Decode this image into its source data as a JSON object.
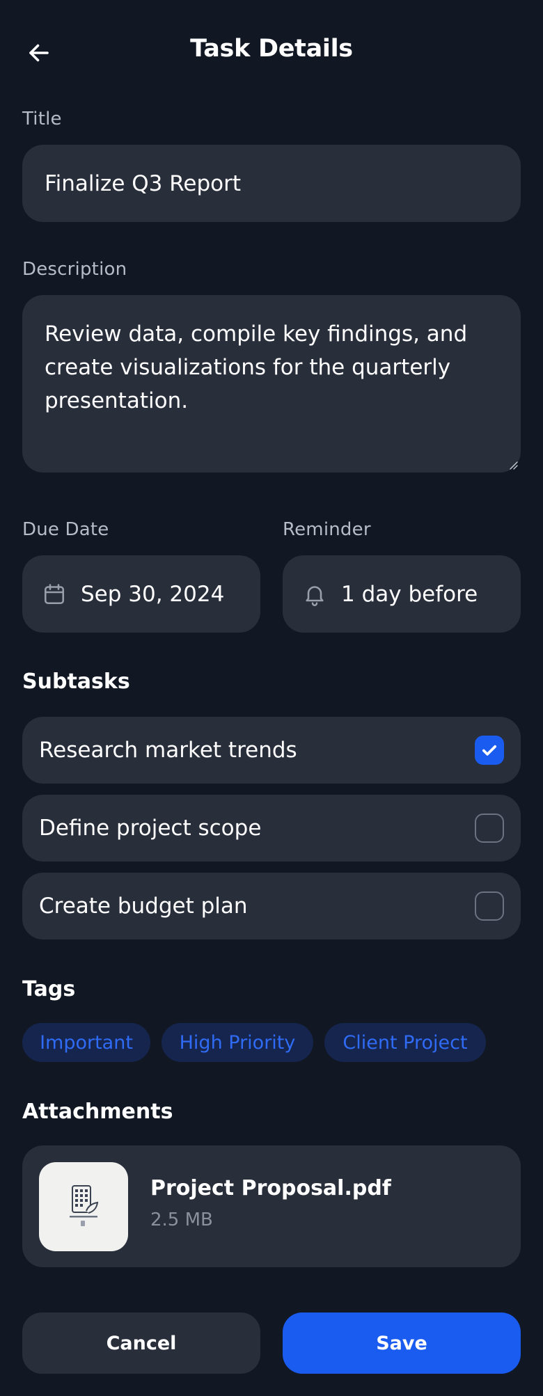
{
  "header": {
    "title": "Task Details",
    "back_icon": "arrow-left-icon"
  },
  "form": {
    "title_label": "Title",
    "title_value": "Finalize Q3 Report",
    "description_label": "Description",
    "description_value": "Review data, compile key findings, and create visualizations for the quarterly presentation.",
    "due_date_label": "Due Date",
    "due_date_value": "Sep 30, 2024",
    "due_date_icon": "calendar-icon",
    "reminder_label": "Reminder",
    "reminder_value": "1 day before",
    "reminder_icon": "bell-icon"
  },
  "subtasks": {
    "title": "Subtasks",
    "items": [
      {
        "label": "Research market trends",
        "checked": true
      },
      {
        "label": "Define project scope",
        "checked": false
      },
      {
        "label": "Create budget plan",
        "checked": false
      }
    ]
  },
  "tags": {
    "title": "Tags",
    "items": [
      "Important",
      "High Priority",
      "Client Project"
    ]
  },
  "attachments": {
    "title": "Attachments",
    "items": [
      {
        "name": "Project Proposal.pdf",
        "size": "2.5 MB"
      }
    ]
  },
  "actions": {
    "cancel_label": "Cancel",
    "save_label": "Save"
  },
  "colors": {
    "background": "#111723",
    "surface": "#292e3b",
    "accent": "#1a5cf0",
    "tag_bg": "#15254d",
    "tag_text": "#2f6bf5"
  }
}
